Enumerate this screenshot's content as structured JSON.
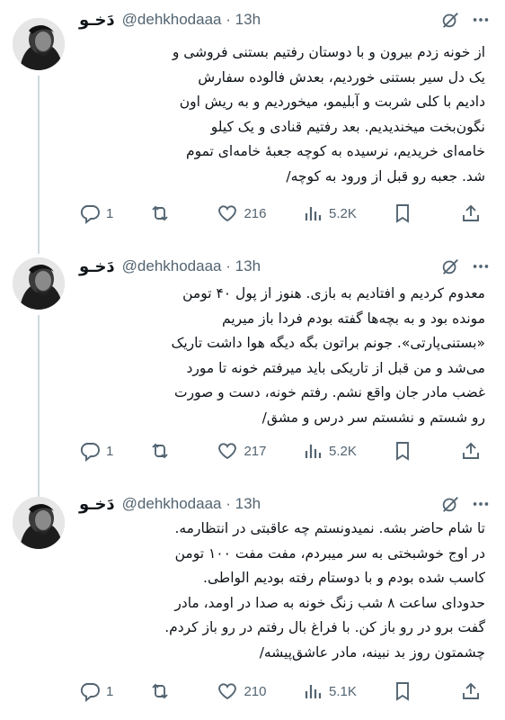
{
  "colors": {
    "text": "#0f1419",
    "muted": "#536471",
    "line": "#cfd9de"
  },
  "tweets": [
    {
      "display_name": "دَخـو",
      "handle": "@dehkhodaaa",
      "separator": "·",
      "time": "13h",
      "text": "از خونه زدم بیرون و با دوستان رفتیم بستنی فروشی و\nیک دل سیر بستنی خوردیم، بعدش فالوده سفارش\nدادیم با کلی شربت و آبلیمو، میخوردیم و به ریش اون\nنگون‌بخت میخندیدیم. بعد رفتیم قنادی و یک کیلو\nخامه‌ای خریدیم، نرسیده به کوچه جعبهٔ خامه‌ای تموم\nشد. جعبه رو قبل از ورود به کوچه/",
      "replies": "1",
      "retweets": "",
      "likes": "216",
      "views": "5.2K"
    },
    {
      "display_name": "دَخـو",
      "handle": "@dehkhodaaa",
      "separator": "·",
      "time": "13h",
      "text": "معدوم کردیم و افتادیم به بازی. هنوز از پول ۴۰ تومن\nمونده بود و به بچه‌ها گفته بودم فردا باز میریم\n«بستنی‌پارتی». جونم براتون بگه دیگه هوا داشت تاریک\nمی‌شد و من قبل از تاریکی باید میرفتم خونه تا مورد\nغضب مادر جان واقع نشم. رفتم خونه، دست و صورت\nرو شستم و نشستم سر درس و مشق/",
      "replies": "1",
      "retweets": "",
      "likes": "217",
      "views": "5.2K"
    },
    {
      "display_name": "دَخـو",
      "handle": "@dehkhodaaa",
      "separator": "·",
      "time": "13h",
      "text": "تا شام حاضر بشه. نمیدونستم چه عاقبتی در انتظارمه.\nدر اوج خوشبختی به سر میبردم، مفت مفت ۱۰۰ تومن\nکاسب شده بودم و با دوستام رفته بودیم الواطی.\nحدودای ساعت ۸ شب زنگ خونه به صدا در اومد، مادر\nگفت برو در رو باز کن. با فراغ بال رفتم در رو باز کردم.\nچشمتون روز بد نبینه، مادر عاشق‌پیشه/",
      "replies": "1",
      "retweets": "",
      "likes": "210",
      "views": "5.1K"
    }
  ]
}
